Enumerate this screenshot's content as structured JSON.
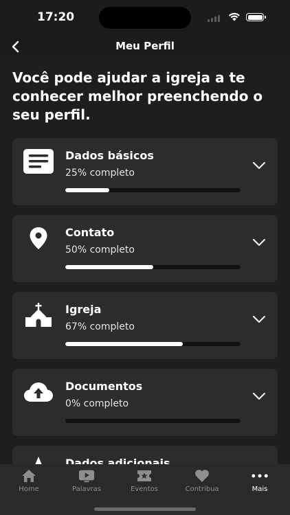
{
  "status_bar": {
    "time": "17:20"
  },
  "nav": {
    "title": "Meu Perfil"
  },
  "intro": "Você pode ajudar a igreja a te conhecer melhor preenchendo o seu perfil.",
  "sections": [
    {
      "title": "Dados básicos",
      "progress_text": "25% completo",
      "progress": 0.25,
      "icon": "document-icon"
    },
    {
      "title": "Contato",
      "progress_text": "50% completo",
      "progress": 0.5,
      "icon": "location-pin-icon"
    },
    {
      "title": "Igreja",
      "progress_text": "67% completo",
      "progress": 0.67,
      "icon": "church-icon"
    },
    {
      "title": "Documentos",
      "progress_text": "0% completo",
      "progress": 0.0,
      "icon": "cloud-upload-icon"
    },
    {
      "title": "Dados adicionais",
      "icon": "star-icon"
    }
  ],
  "tabs": [
    {
      "label": "Home",
      "icon": "home-icon"
    },
    {
      "label": "Palavras",
      "icon": "video-icon"
    },
    {
      "label": "Eventos",
      "icon": "ticket-icon"
    },
    {
      "label": "Contribua",
      "icon": "heart-icon"
    },
    {
      "label": "Mais",
      "icon": "more-icon",
      "active": true
    }
  ],
  "colors": {
    "background": "#1c1c1c",
    "card": "#2c2c2c",
    "tab_bar": "#2a2a2a",
    "progress_fill": "#ffffff",
    "inactive_tab": "#8e8e8e"
  }
}
